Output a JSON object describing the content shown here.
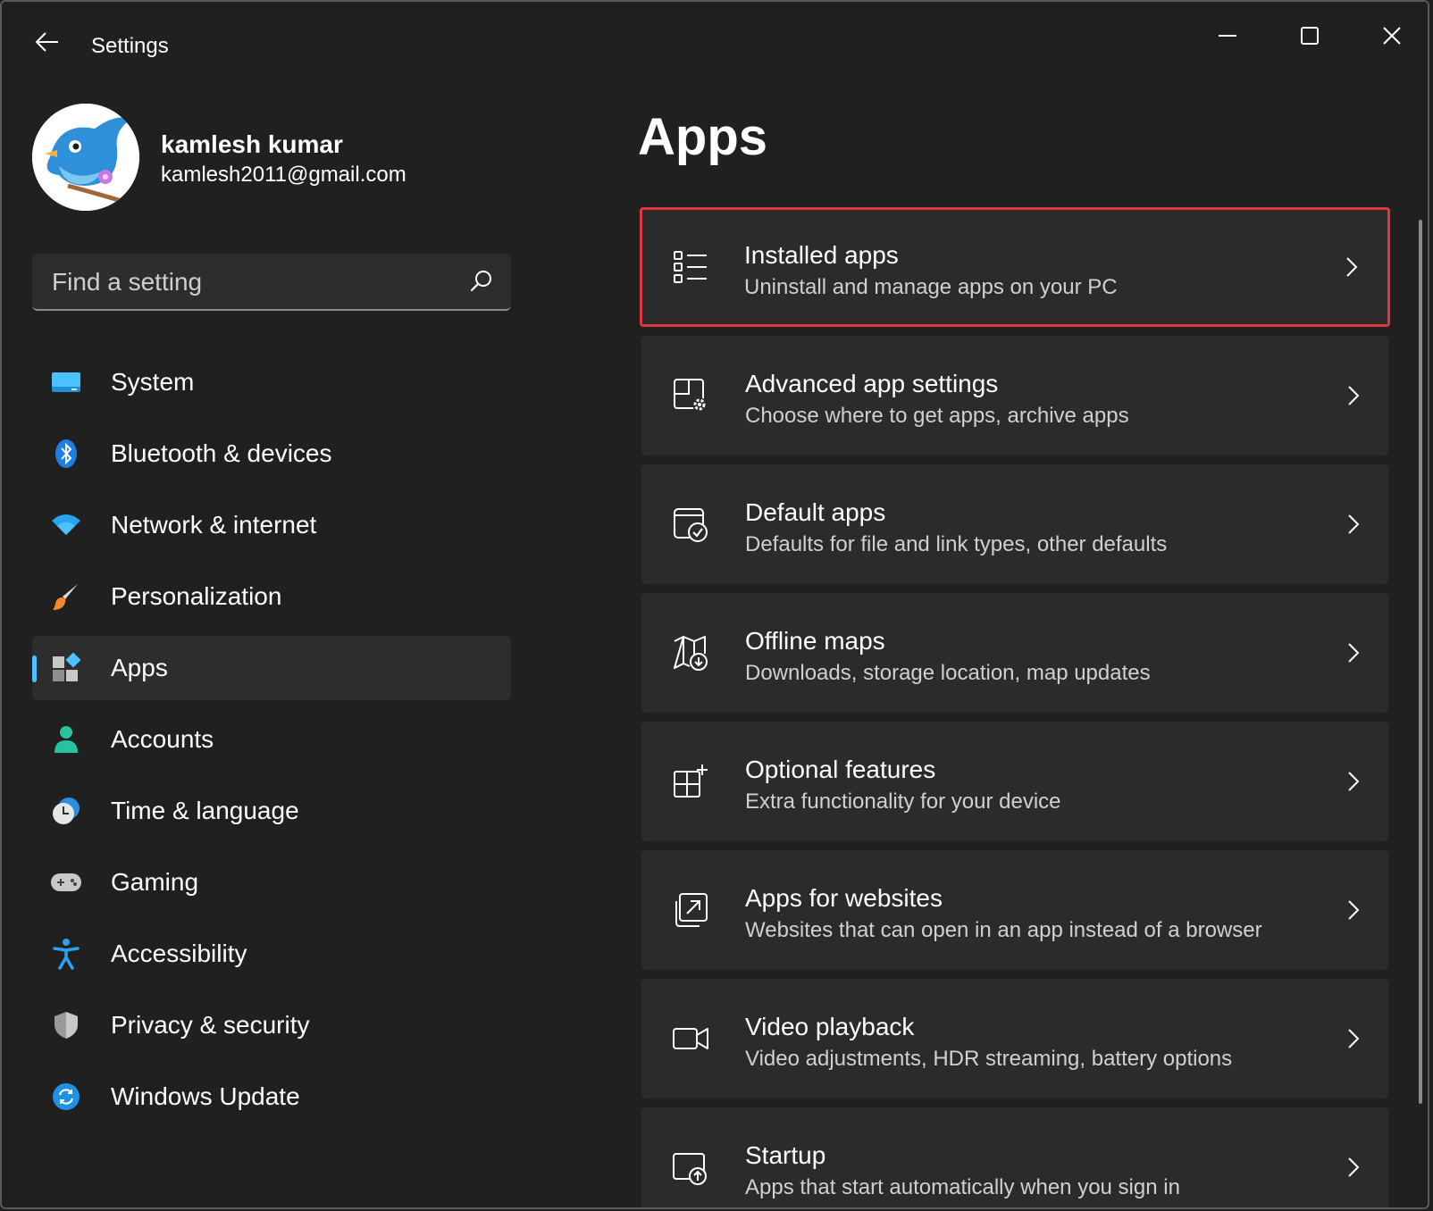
{
  "window": {
    "title": "Settings"
  },
  "profile": {
    "name": "kamlesh kumar",
    "email": "kamlesh2011@gmail.com"
  },
  "search": {
    "placeholder": "Find a setting",
    "value": ""
  },
  "sidebar": {
    "items": [
      {
        "label": "System",
        "icon": "system-icon",
        "selected": false
      },
      {
        "label": "Bluetooth & devices",
        "icon": "bluetooth-icon",
        "selected": false
      },
      {
        "label": "Network & internet",
        "icon": "wifi-icon",
        "selected": false
      },
      {
        "label": "Personalization",
        "icon": "brush-icon",
        "selected": false
      },
      {
        "label": "Apps",
        "icon": "apps-icon",
        "selected": true
      },
      {
        "label": "Accounts",
        "icon": "accounts-icon",
        "selected": false
      },
      {
        "label": "Time & language",
        "icon": "clock-globe-icon",
        "selected": false
      },
      {
        "label": "Gaming",
        "icon": "gamepad-icon",
        "selected": false
      },
      {
        "label": "Accessibility",
        "icon": "accessibility-icon",
        "selected": false
      },
      {
        "label": "Privacy & security",
        "icon": "shield-icon",
        "selected": false
      },
      {
        "label": "Windows Update",
        "icon": "update-icon",
        "selected": false
      }
    ]
  },
  "main": {
    "title": "Apps",
    "cards": [
      {
        "title": "Installed apps",
        "subtitle": "Uninstall and manage apps on your PC",
        "icon": "list-icon",
        "highlighted": true
      },
      {
        "title": "Advanced app settings",
        "subtitle": "Choose where to get apps, archive apps",
        "icon": "apps-gear-icon",
        "highlighted": false
      },
      {
        "title": "Default apps",
        "subtitle": "Defaults for file and link types, other defaults",
        "icon": "default-apps-check-icon",
        "highlighted": false
      },
      {
        "title": "Offline maps",
        "subtitle": "Downloads, storage location, map updates",
        "icon": "map-download-icon",
        "highlighted": false
      },
      {
        "title": "Optional features",
        "subtitle": "Extra functionality for your device",
        "icon": "grid-plus-icon",
        "highlighted": false
      },
      {
        "title": "Apps for websites",
        "subtitle": "Websites that can open in an app instead of a browser",
        "icon": "open-external-icon",
        "highlighted": false
      },
      {
        "title": "Video playback",
        "subtitle": "Video adjustments, HDR streaming, battery options",
        "icon": "video-camera-icon",
        "highlighted": false
      },
      {
        "title": "Startup",
        "subtitle": "Apps that start automatically when you sign in",
        "icon": "startup-icon",
        "highlighted": false
      }
    ]
  },
  "colors": {
    "background": "#202020",
    "card": "#2b2b2b",
    "accent": "#4cc2ff",
    "highlight_border": "#e0383e"
  }
}
